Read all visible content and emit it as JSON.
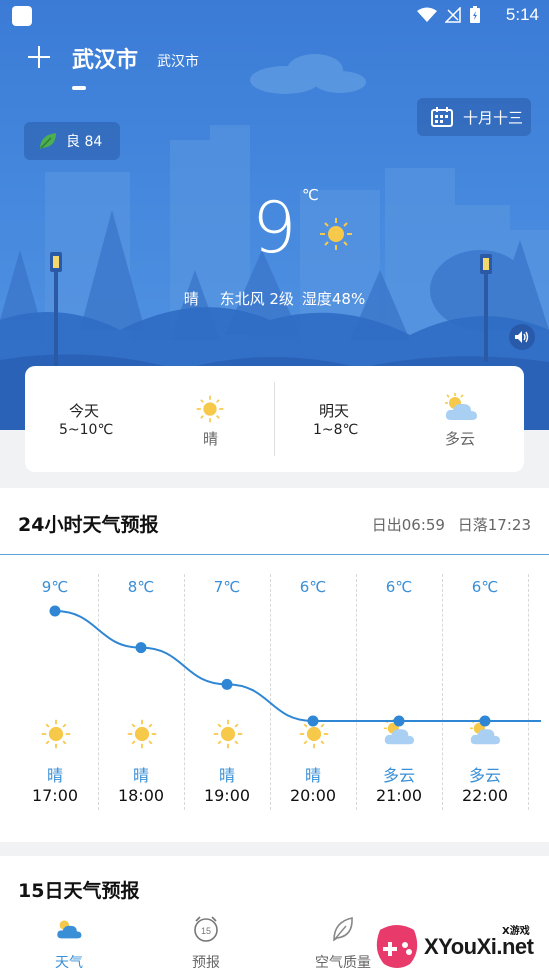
{
  "status_bar": {
    "time": "5:14"
  },
  "header": {
    "add_icon": "plus-icon",
    "city": "武汉市",
    "city_sub": "武汉市"
  },
  "aqi": {
    "label": "良 84",
    "icon": "leaf-icon",
    "color": "#4caf50"
  },
  "lunar_date": {
    "label": "十月十三",
    "icon": "calendar-icon"
  },
  "current": {
    "temp": "9",
    "unit": "℃",
    "icon": "sun-icon",
    "condition": "晴",
    "wind": "东北风 2级",
    "humidity": "湿度48%"
  },
  "days": [
    {
      "label": "今天",
      "range": "5~10℃",
      "condition": "晴",
      "icon": "sun-icon"
    },
    {
      "label": "明天",
      "range": "1~8℃",
      "condition": "多云",
      "icon": "partly-cloudy-icon"
    }
  ],
  "hourly": {
    "title": "24小时天气预报",
    "sunrise": "日出06:59",
    "sunset": "日落17:23",
    "items": [
      {
        "temp_label": "9℃",
        "temp": 9,
        "condition": "晴",
        "time": "17:00",
        "icon": "sun-icon"
      },
      {
        "temp_label": "8℃",
        "temp": 8,
        "condition": "晴",
        "time": "18:00",
        "icon": "sun-icon"
      },
      {
        "temp_label": "7℃",
        "temp": 7,
        "condition": "晴",
        "time": "19:00",
        "icon": "sun-icon"
      },
      {
        "temp_label": "6℃",
        "temp": 6,
        "condition": "晴",
        "time": "20:00",
        "icon": "sun-icon"
      },
      {
        "temp_label": "6℃",
        "temp": 6,
        "condition": "多云",
        "time": "21:00",
        "icon": "partly-cloudy-icon"
      },
      {
        "temp_label": "6℃",
        "temp": 6,
        "condition": "多云",
        "time": "22:00",
        "icon": "partly-cloudy-icon"
      }
    ]
  },
  "fifteen_day": {
    "title": "15日天气预报"
  },
  "nav": [
    {
      "label": "天气",
      "icon": "weather-icon",
      "active": true
    },
    {
      "label": "预报",
      "icon": "forecast-15-icon",
      "active": false
    },
    {
      "label": "空气质量",
      "icon": "leaf-outline-icon",
      "active": false
    }
  ],
  "watermark": {
    "small": "X游戏",
    "text": "XYouXi.net"
  },
  "colors": {
    "accent": "#3a8fd6",
    "hero_top": "#3b7bd6",
    "curve": "#2f86d4"
  }
}
